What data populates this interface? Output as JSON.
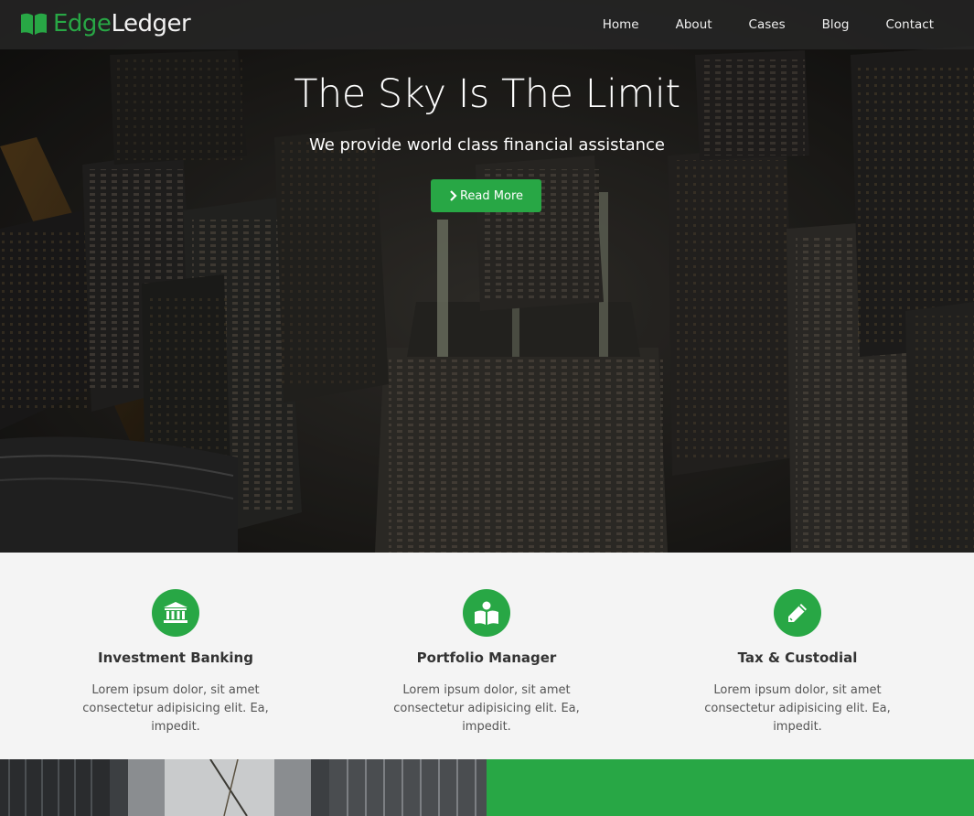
{
  "brand": {
    "part1": "Edge",
    "part2": "Ledger",
    "icon": "open-book-icon"
  },
  "nav": {
    "items": [
      "Home",
      "About",
      "Cases",
      "Blog",
      "Contact"
    ]
  },
  "hero": {
    "title": "The Sky Is The Limit",
    "subtitle": "We provide world class financial assistance",
    "button_label": "Read More",
    "button_icon": "chevron-right-icon"
  },
  "features": [
    {
      "icon": "bank-icon",
      "title": "Investment Banking",
      "desc": "Lorem ipsum dolor, sit amet consectetur adipisicing elit. Ea, impedit."
    },
    {
      "icon": "reader-icon",
      "title": "Portfolio Manager",
      "desc": "Lorem ipsum dolor, sit amet consectetur adipisicing elit. Ea, impedit."
    },
    {
      "icon": "pencil-icon",
      "title": "Tax & Custodial",
      "desc": "Lorem ipsum dolor, sit amet consectetur adipisicing elit. Ea, impedit."
    }
  ],
  "colors": {
    "accent": "#28a745",
    "navbar": "#2b2b2b",
    "section_bg": "#f4f4f4"
  }
}
